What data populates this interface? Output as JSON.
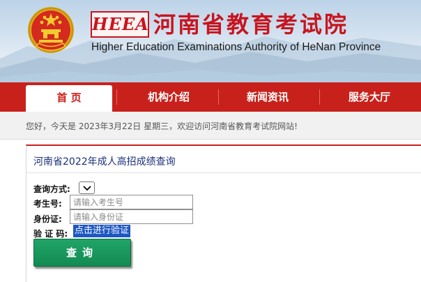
{
  "header": {
    "logo_abbr": "HEEA",
    "title_cn": "河南省教育考试院",
    "title_en": "Higher Education Examinations Authority of HeNan Province",
    "emblem_icon": "national-emblem-icon",
    "colors": {
      "brand_red": "#c8141e",
      "nav_red": "#c8211c"
    }
  },
  "nav": {
    "items": [
      {
        "label": "首 页",
        "active": true
      },
      {
        "label": "机构介绍",
        "active": false
      },
      {
        "label": "新闻资讯",
        "active": false
      },
      {
        "label": "服务大厅",
        "active": false
      }
    ]
  },
  "greeting": "您好，今天是 2023年3月22日 星期三，欢迎访问河南省教育考试院网站!",
  "query_panel": {
    "title": "河南省2022年成人高招成绩查询",
    "method_label": "查询方式:",
    "method_selected": "",
    "exam_no_label": "考生号:",
    "exam_no_placeholder": "请输入考生号",
    "id_label": "身份证:",
    "id_placeholder": "请输入身份证",
    "captcha_label": "验 证 码:",
    "captcha_link": "点击进行验证",
    "submit_label": "查询",
    "colors": {
      "button_green": "#179a5c",
      "link_highlight": "#1c57c4",
      "title_blue": "#1b2f7a"
    }
  }
}
